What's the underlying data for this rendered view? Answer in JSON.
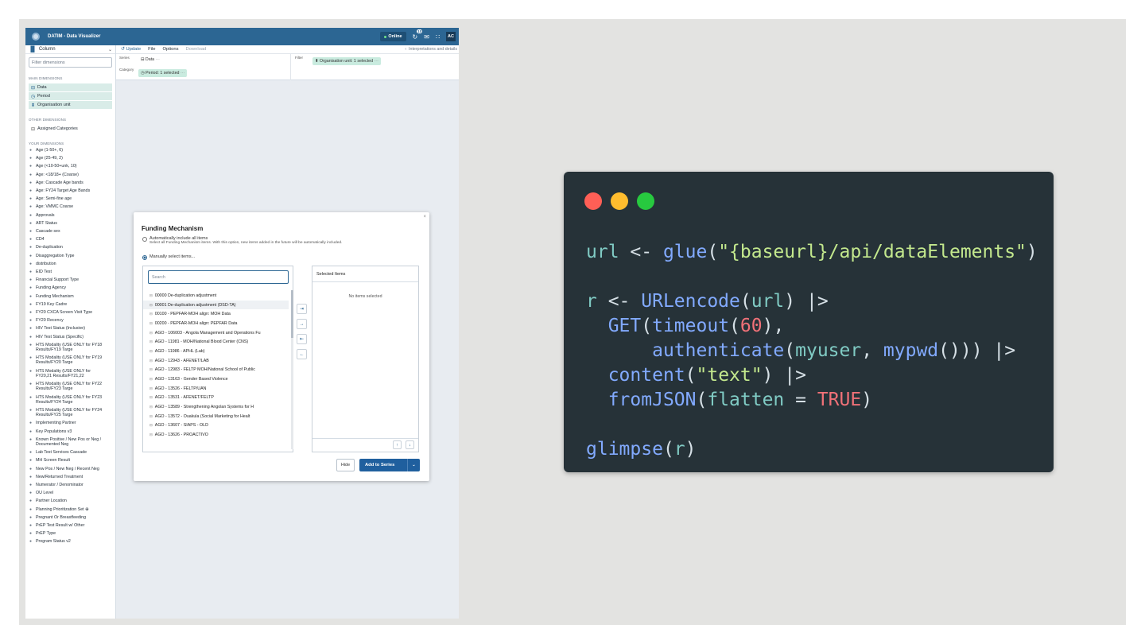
{
  "datim": {
    "app_title": "DATIM - Data Visualizer",
    "online_label": "Online",
    "notification_count": "10",
    "avatar_initials": "AC",
    "visualization_type": "Column",
    "filter_placeholder": "Filter dimensions",
    "menu": {
      "update": "Update",
      "file": "File",
      "options": "Options",
      "download": "Download",
      "interpretations": "Interpretations and details"
    },
    "layout": {
      "series_label": "Series",
      "category_label": "Category",
      "filter_label": "Filter",
      "series_chip": "Data",
      "category_chip": "Period: 1 selected",
      "filter_chip": "Organisation unit: 1 selected"
    },
    "sections": {
      "main": "MAIN DIMENSIONS",
      "other": "OTHER DIMENSIONS",
      "yours": "YOUR DIMENSIONS"
    },
    "main_dimensions": [
      "Data",
      "Period",
      "Organisation unit"
    ],
    "other_dimensions": [
      "Assigned Categories"
    ],
    "your_dimensions": [
      "Age (1-50+, 6)",
      "Age (25-49, 2)",
      "Age (<10-50+unk, 10)",
      "Age: <18/18+ (Coarse)",
      "Age: Cascade Age bands",
      "Age: FY24 Target Age Bands",
      "Age: Semi-fine age",
      "Age: VMMC Coarse",
      "Approvals",
      "ART Status",
      "Cascade sex",
      "CD4",
      "De-duplication",
      "Disaggregation Type",
      "distribution",
      "EID Test",
      "Financial Support Type",
      "Funding Agency",
      "Funding Mechanism",
      "FY19 Key Cadre",
      "FY20 CXCA Screen Visit Type",
      "FY20 Recency",
      "HIV Test Status (Inclusive)",
      "HIV Test Status (Specific)",
      "HTS Modality (USE ONLY for FY18 Results/FY19 Targe",
      "HTS Modality (USE ONLY for FY19 Results/FY20 Targe",
      "HTS Modality (USE ONLY for FY20,21 Results/FY21,22",
      "HTS Modality (USE ONLY for FY22 Results/FY23 Targe",
      "HTS Modality (USE ONLY for FY23 Results/FY24 Targe",
      "HTS Modality (USE ONLY for FY24 Results/FY25 Targe",
      "Implementing Partner",
      "Key Populations v3",
      "Known Positive / New Pos or Neg / Documented Neg",
      "Lab Test Services Cascade",
      "MH Screen Result",
      "New Pos / New Neg / Recent Neg",
      "New/Returned Treatment",
      "Numerator / Denominator",
      "OU Level",
      "Partner Location",
      "Planning Prioritization Set ⊕",
      "Pregnant Or Breastfeeding",
      "PrEP Test Result w/ Other",
      "PrEP Type",
      "Program Status v2"
    ],
    "dialog": {
      "title": "Funding Mechanism",
      "auto_option": "Automatically include all items",
      "auto_desc": "Select all Funding Mechanism items. With this option, new items added in the future will be automatically included.",
      "manual_option": "Manually select items...",
      "search_placeholder": "Search",
      "selected_title": "Selected Items",
      "no_items": "No items selected",
      "hide": "Hide",
      "add": "Add to Series",
      "options": [
        "00000 De-duplication adjustment",
        "00001 De-duplication adjustment (DSD-TA)",
        "00100 - PEPFAR-MOH align: MOH Data",
        "00200 - PEPFAR-MOH align: PEPFAR Data",
        "AGO - 106003 - Angola Management and Operations Fu",
        "AGO - 11981 - MOH/National Blood Center (CNS)",
        "AGO - 11986 - APHL (Lab)",
        "AGO - 12943 - AFENET/LAB",
        "AGO - 12983 - FELTP MOH/National School of Public",
        "AGO - 13163 - Gender Based Violence",
        "AGO - 13526 - FELTP/UAN",
        "AGO - 13531 - AFENET/FELTP",
        "AGO - 13589 - Strengthening Angolan Systems for H",
        "AGO - 13572 - Ouakula (Social Marketing for Healt",
        "AGO - 13607 - SIAPS - OLD",
        "AGO - 13626 - PROACTIVO"
      ]
    }
  },
  "code": {
    "dot_colors": [
      "#ff5f56",
      "#ffbd2e",
      "#27c93f"
    ],
    "lines": [
      [
        {
          "t": "url",
          "c": "var"
        },
        {
          "t": " <- ",
          "c": "op"
        },
        {
          "t": "glue",
          "c": "fn"
        },
        {
          "t": "(",
          "c": "op"
        },
        {
          "t": "\"{baseurl}/api/dataElements\"",
          "c": "str"
        },
        {
          "t": ")",
          "c": "op"
        }
      ],
      [],
      [
        {
          "t": "r",
          "c": "var"
        },
        {
          "t": " <- ",
          "c": "op"
        },
        {
          "t": "URLencode",
          "c": "fn"
        },
        {
          "t": "(",
          "c": "op"
        },
        {
          "t": "url",
          "c": "var"
        },
        {
          "t": ") |>",
          "c": "op"
        }
      ],
      [
        {
          "t": "  ",
          "c": "op"
        },
        {
          "t": "GET",
          "c": "fn"
        },
        {
          "t": "(",
          "c": "op"
        },
        {
          "t": "timeout",
          "c": "fn"
        },
        {
          "t": "(",
          "c": "op"
        },
        {
          "t": "60",
          "c": "num"
        },
        {
          "t": "),",
          "c": "op"
        }
      ],
      [
        {
          "t": "      ",
          "c": "op"
        },
        {
          "t": "authenticate",
          "c": "fn"
        },
        {
          "t": "(",
          "c": "op"
        },
        {
          "t": "myuser",
          "c": "var"
        },
        {
          "t": ", ",
          "c": "op"
        },
        {
          "t": "mypwd",
          "c": "fn"
        },
        {
          "t": "())) |>",
          "c": "op"
        }
      ],
      [
        {
          "t": "  ",
          "c": "op"
        },
        {
          "t": "content",
          "c": "fn"
        },
        {
          "t": "(",
          "c": "op"
        },
        {
          "t": "\"text\"",
          "c": "str"
        },
        {
          "t": ") |>",
          "c": "op"
        }
      ],
      [
        {
          "t": "  ",
          "c": "op"
        },
        {
          "t": "fromJSON",
          "c": "fn"
        },
        {
          "t": "(",
          "c": "op"
        },
        {
          "t": "flatten",
          "c": "var"
        },
        {
          "t": " = ",
          "c": "op"
        },
        {
          "t": "TRUE",
          "c": "num"
        },
        {
          "t": ")",
          "c": "op"
        }
      ],
      [],
      [
        {
          "t": "glimpse",
          "c": "fn"
        },
        {
          "t": "(",
          "c": "op"
        },
        {
          "t": "r",
          "c": "var"
        },
        {
          "t": ")",
          "c": "op"
        }
      ]
    ]
  }
}
